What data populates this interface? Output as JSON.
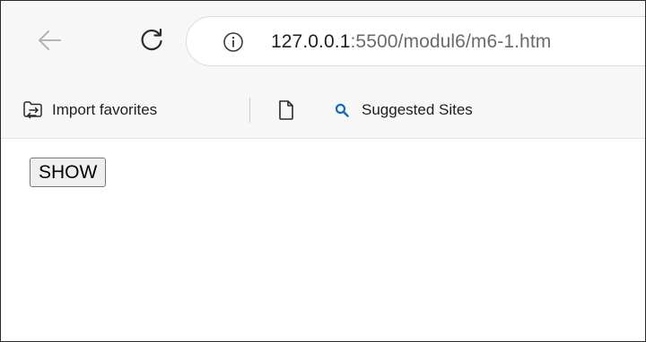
{
  "browser": {
    "address": {
      "host": "127.0.0.1",
      "path": ":5500/modul6/m6-1.htm"
    },
    "favorites": [
      {
        "label": "Import favorites",
        "icon": "import-favorites-icon"
      },
      {
        "label": "",
        "icon": "page-icon"
      },
      {
        "label": "Suggested Sites",
        "icon": "search-icon"
      }
    ]
  },
  "page": {
    "show_button_label": "SHOW"
  },
  "colors": {
    "chrome_bg": "#f7f7f7",
    "search_icon": "#0f6cbd",
    "url_host": "#1f1f1f",
    "url_path": "#6b6b6b"
  }
}
